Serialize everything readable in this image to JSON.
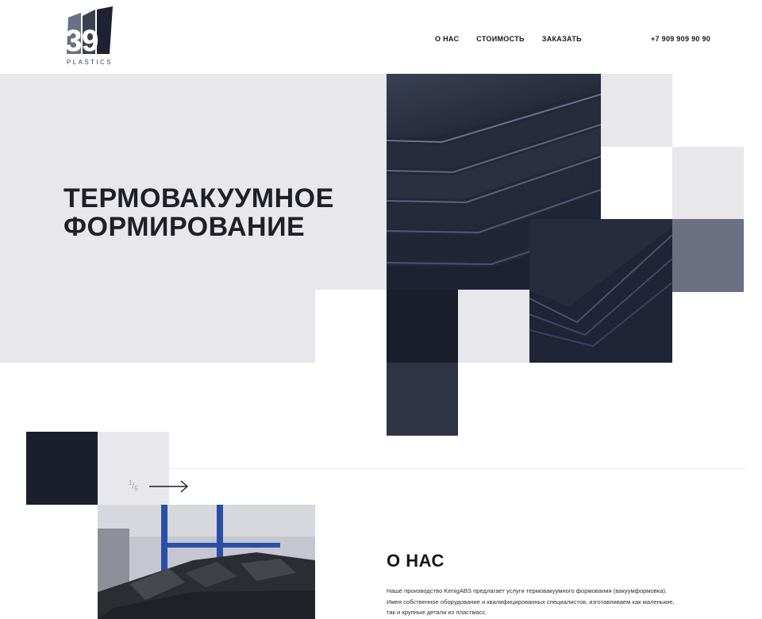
{
  "header": {
    "logo": {
      "number": "39",
      "text": "PLASTICS"
    },
    "nav": [
      {
        "label": "О НАС"
      },
      {
        "label": "СТОИМОСТЬ"
      },
      {
        "label": "ЗАКАЗАТЬ"
      }
    ],
    "phone": "+7 909 909 90 90"
  },
  "hero": {
    "title_line1": "ТЕРМОВАКУУМНОЕ",
    "title_line2": "ФОРМИРОВАНИЕ"
  },
  "slider": {
    "current": "1",
    "total": "5"
  },
  "about": {
    "title": "О НАС",
    "text": "Наше производство KenigABS предлагает услуги термовакуумного формования (вакуумформовка). Имея собственное оборудование и квалифицированных специалистов, изготавливаем как маленькие, так и крупные детали из пластмасс."
  },
  "colors": {
    "hero_bg": "#e7e7ec",
    "dark_navy": "#1b1f2c",
    "slate": "#6b7082",
    "accent_blue": "#2c4fa6"
  }
}
